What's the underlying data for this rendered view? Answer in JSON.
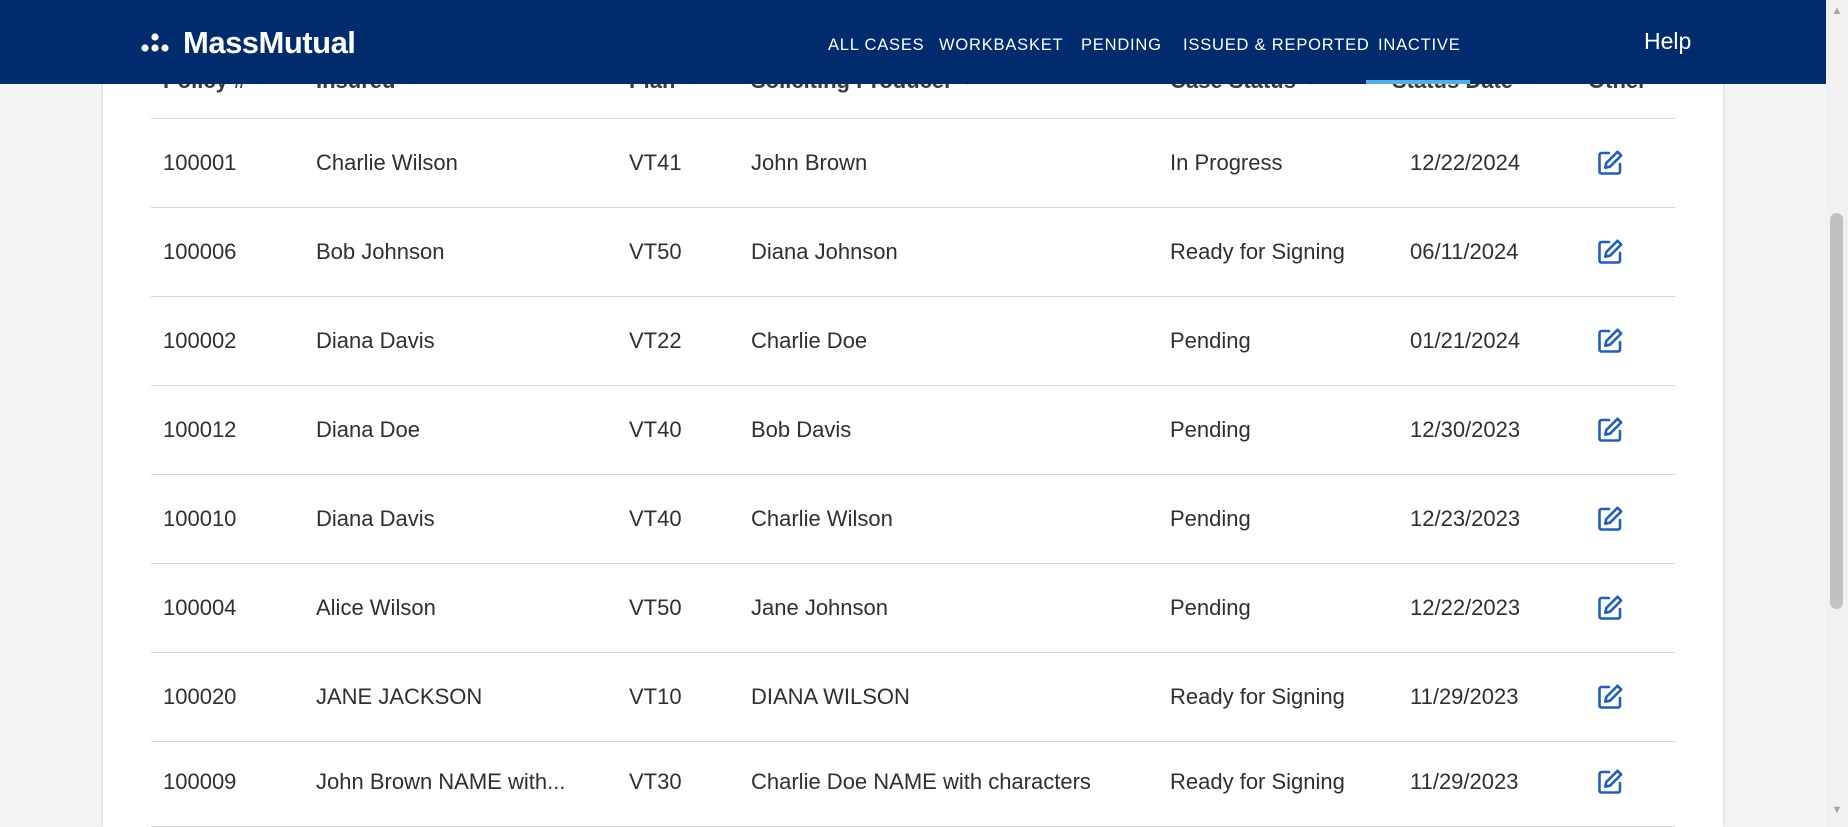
{
  "nav": {
    "brand": "MassMutual",
    "tabs": [
      "ALL CASES",
      "WORKBASKET",
      "PENDING",
      "ISSUED & REPORTED",
      "INACTIVE"
    ],
    "help": "Help"
  },
  "table": {
    "columns": [
      "Policy #",
      "Insured",
      "Plan",
      "Soliciting Producer",
      "Case Status",
      "Status Date",
      "Other"
    ],
    "rows": [
      [
        "100001",
        "Charlie Wilson",
        "VT41",
        "John Brown",
        "In Progress",
        "12/22/2024"
      ],
      [
        "100006",
        "Bob Johnson",
        "VT50",
        "Diana Johnson",
        "Ready for Signing",
        "06/11/2024"
      ],
      [
        "100002",
        "Diana Davis",
        "VT22",
        "Charlie Doe",
        "Pending",
        "01/21/2024"
      ],
      [
        "100012",
        "Diana Doe",
        "VT40",
        "Bob Davis",
        "Pending",
        "12/30/2023"
      ],
      [
        "100010",
        "Diana Davis",
        "VT40",
        "Charlie Wilson",
        "Pending",
        "12/23/2023"
      ],
      [
        "100004",
        "Alice Wilson",
        "VT50",
        "Jane Johnson",
        "Pending",
        "12/22/2023"
      ],
      [
        "100020",
        "JANE JACKSON",
        "VT10",
        "DIANA WILSON",
        "Ready for Signing",
        "11/29/2023"
      ],
      [
        "100009",
        "John Brown NAME with...",
        "VT30",
        "Charlie Doe NAME with characters",
        "Ready for Signing",
        "11/29/2023"
      ]
    ]
  },
  "colors": {
    "nav_bg": "#002c6e",
    "tab_active_underline": "#4fb2e3",
    "edit_icon": "#1f5fbf"
  }
}
